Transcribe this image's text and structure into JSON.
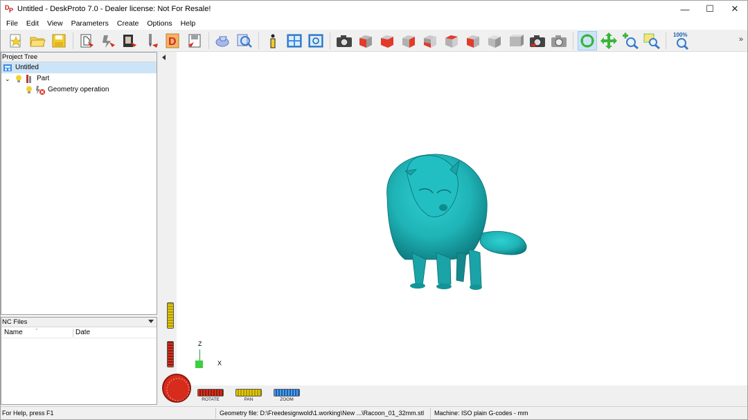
{
  "window": {
    "title": "Untitled - DeskProto 7.0 - Dealer license: Not For Resale!",
    "app_icon_letters": [
      "D",
      "P"
    ],
    "controls": {
      "minimize": "—",
      "maximize": "☐",
      "close": "✕"
    }
  },
  "menu": [
    "File",
    "Edit",
    "View",
    "Parameters",
    "Create",
    "Options",
    "Help"
  ],
  "toolbar": {
    "groups": [
      [
        "new-project-icon",
        "open-folder-icon",
        "save-icon"
      ],
      [
        "part-parameters-icon",
        "operation-parameters-icon",
        "machine-parameters-icon",
        "cutter-icon",
        "dp-wizard-icon",
        "export-icon"
      ],
      [
        "pencil-eraser-icon",
        "inspect-icon"
      ],
      [
        "info-icon",
        "window-layout-icon",
        "preview-icon"
      ],
      [
        "camera-icon",
        "view-front-icon",
        "view-right-icon",
        "view-back-icon",
        "view-left-icon",
        "view-top-icon",
        "view-bottom-icon",
        "view-iso-icon",
        "view-iso2-icon",
        "snapshot-icon",
        "snapshot-settings-icon"
      ],
      [
        "rotate-mode-icon",
        "pan-mode-icon",
        "zoom-mode-icon",
        "zoom-window-icon"
      ],
      [
        "zoom-100-icon"
      ]
    ],
    "zoom_label": "100%",
    "more": "»"
  },
  "project_tree": {
    "header": "Project Tree",
    "items": [
      {
        "label": "Untitled"
      },
      {
        "label": "Part"
      },
      {
        "label": "Geometry operation"
      }
    ]
  },
  "nc_files": {
    "header": "NC Files",
    "columns": [
      "Name",
      "Date"
    ]
  },
  "viewport": {
    "axes": {
      "z": "Z",
      "x": "X"
    },
    "model_color": "#1fb3b6",
    "wheels": {
      "rotate": "ROTATE",
      "pan": "PAN",
      "zoom": "ZOOM"
    }
  },
  "status": {
    "help": "For Help, press F1",
    "geometry": "Geometry file: D:\\Freedesignwold\\1.working\\New ...\\Racoon_01_32mm.stl",
    "machine": "Machine: ISO plain G-codes - mm"
  }
}
